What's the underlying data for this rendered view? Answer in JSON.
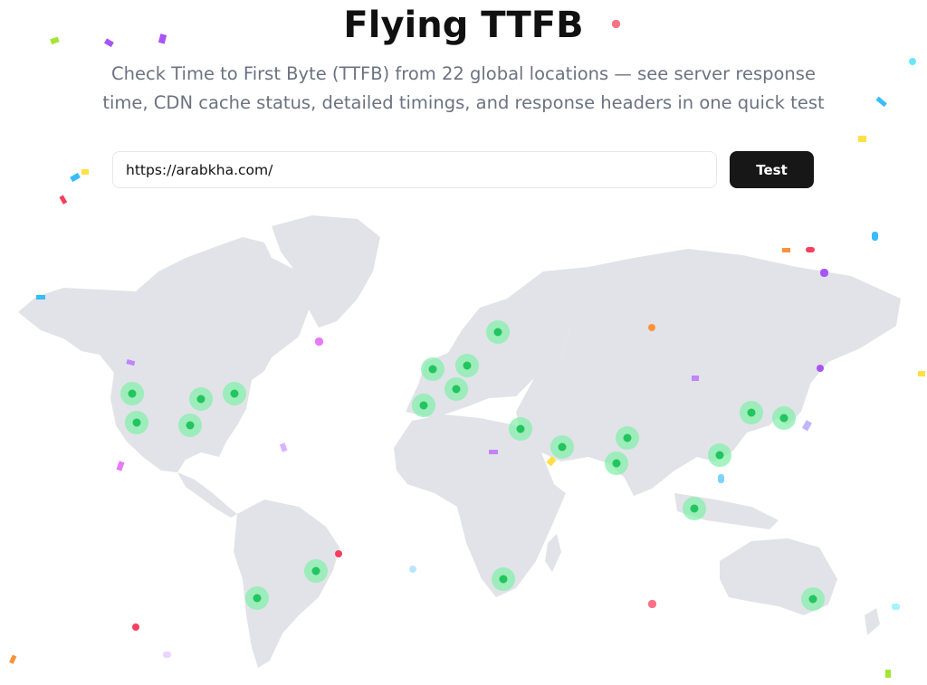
{
  "header": {
    "title": "Flying TTFB",
    "subtitle": "Check Time to First Byte (TTFB) from 22 global locations — see server response time, CDN cache status, detailed timings, and response headers in one quick test"
  },
  "form": {
    "url_value": "https://arabkha.com/",
    "test_label": "Test"
  },
  "colors": {
    "land": "#e1e3e8",
    "location_marker": "#22c55e",
    "location_halo": "#86efac",
    "button": "#171717"
  },
  "map": {
    "location_count": 22,
    "locations": [
      "us-west-north",
      "us-west-south",
      "us-central",
      "us-south",
      "us-east",
      "brazil",
      "chile",
      "uk",
      "netherlands",
      "germany",
      "spain",
      "sweden",
      "israel",
      "uae",
      "south-africa",
      "india-north",
      "india-south",
      "singapore",
      "hong-kong",
      "indonesia",
      "korea",
      "japan",
      "australia"
    ]
  }
}
